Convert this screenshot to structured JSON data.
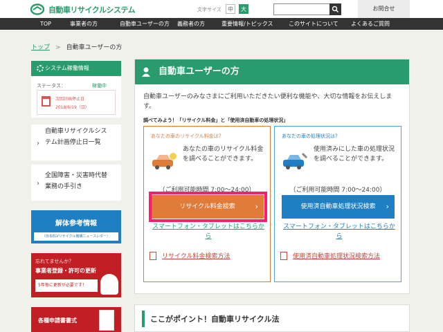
{
  "header": {
    "logo_text": "自動車リサイクルシステム",
    "font_size_label": "文字サイズ",
    "font_small": "中",
    "font_large": "大",
    "search_placeholder": "",
    "notice": "お問合せ"
  },
  "nav": [
    "TOP",
    "事業者の方",
    "自動車ユーザーの方",
    "義務者の方",
    "重要情報/トピックス",
    "このサイトについて",
    "よくあるご質問"
  ],
  "breadcrumb": {
    "home": "トップ",
    "sep": ">",
    "current": "自動車ユーザーの方"
  },
  "sidebar": {
    "system": {
      "title": "システム稼働情報",
      "status_label": "ステータス：",
      "status_value": "稼働中",
      "next_l1": "次回計画停止日",
      "next_l2": "2018/8/19（日）"
    },
    "link1": "自動車リサイクルシステム計画停止日一覧",
    "link2": "全国障害・災害時代替業務の手引き",
    "kaitai": {
      "title": "解体参考情報",
      "sub": "（日本ELVリサイクル機構ニュースレター）"
    },
    "renew": {
      "l1": "忘れてませんか？",
      "l2": "事業者登録・許可の更新",
      "l3": "5年毎に更新が必要です！"
    },
    "forms": "各種申請書書式"
  },
  "main": {
    "title": "自動車ユーザーの方",
    "intro": "自動車ユーザーのみなさまにご利用いただきたい便利な機能や、大切な情報をお伝えします。",
    "sub": "調べてみよう！「リサイクル料金」と「使用済自動車の処理状況」",
    "card1": {
      "question": "あなたの車のリサイクル料金は？",
      "desc": "あなたの車のリサイクル料金を調べることができます。",
      "hours": "（ご利用可能時間 7:00～24:00）",
      "button": "リサイクル料金検索",
      "smart": "スマートフォン・タブレットはこちらから",
      "pdf": "リサイクル料金検索方法"
    },
    "card2": {
      "question": "あなたの車の処理状況は？",
      "desc": "使用済みにした車の処理状況を調べることができます。",
      "hours": "（ご利用可能時間 7:00～24:00）",
      "button": "使用済自動車処理状況検索",
      "smart": "スマートフォン・タブレットはこちらから",
      "pdf": "使用済自動車処理状況検索方法"
    }
  },
  "point": "ここがポイント！自動車リサイクル法"
}
